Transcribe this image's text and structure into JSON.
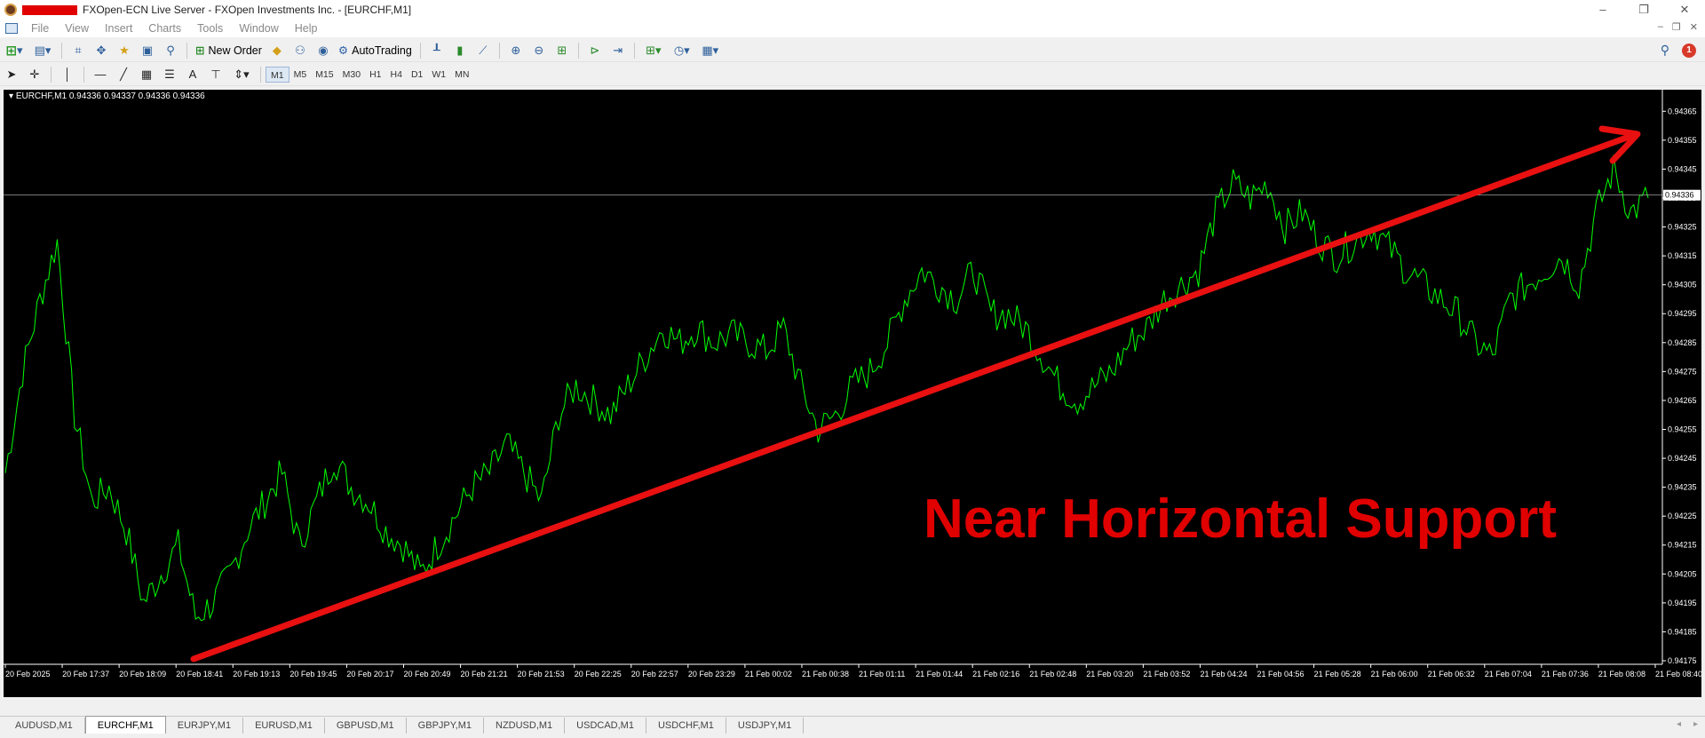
{
  "window": {
    "title": "FXOpen-ECN Live Server - FXOpen Investments Inc. - [EURCHF,M1]",
    "controls": [
      "–",
      "❐",
      "✕"
    ]
  },
  "menu": [
    "File",
    "View",
    "Insert",
    "Charts",
    "Tools",
    "Window",
    "Help"
  ],
  "toolbar": {
    "new_order": "New Order",
    "auto_trading": "AutoTrading",
    "notification_count": "1"
  },
  "timeframes": [
    "M1",
    "M5",
    "M15",
    "M30",
    "H1",
    "H4",
    "D1",
    "W1",
    "MN"
  ],
  "active_timeframe": "M1",
  "chart": {
    "symbol_info": "EURCHF,M1  0.94336 0.94337 0.94336 0.94336",
    "current_price": "0.94336",
    "annotation": "Near Horizontal Support",
    "colors": {
      "background": "#000000",
      "line": "#00ff00",
      "trendline": "#e81010",
      "annotation": "#e00000",
      "axis": "#ffffff"
    }
  },
  "chart_data": {
    "type": "line",
    "ylim": [
      0.94175,
      0.9437
    ],
    "y_ticks": [
      "0.94365",
      "0.94355",
      "0.94345",
      "0.94335",
      "0.94325",
      "0.94315",
      "0.94305",
      "0.94295",
      "0.94285",
      "0.94275",
      "0.94265",
      "0.94255",
      "0.94245",
      "0.94235",
      "0.94225",
      "0.94215",
      "0.94205",
      "0.94195",
      "0.94185",
      "0.94175"
    ],
    "x_ticks": [
      "20 Feb 2025",
      "20 Feb 17:37",
      "20 Feb 18:09",
      "20 Feb 18:41",
      "20 Feb 19:13",
      "20 Feb 19:45",
      "20 Feb 20:17",
      "20 Feb 20:49",
      "20 Feb 21:21",
      "20 Feb 21:53",
      "20 Feb 22:25",
      "20 Feb 22:57",
      "20 Feb 23:29",
      "21 Feb 00:02",
      "21 Feb 00:38",
      "21 Feb 01:11",
      "21 Feb 01:44",
      "21 Feb 02:16",
      "21 Feb 02:48",
      "21 Feb 03:20",
      "21 Feb 03:52",
      "21 Feb 04:24",
      "21 Feb 04:56",
      "21 Feb 05:28",
      "21 Feb 06:00",
      "21 Feb 06:32",
      "21 Feb 07:04",
      "21 Feb 07:36",
      "21 Feb 08:08",
      "21 Feb 08:40"
    ],
    "series": [
      {
        "values": [
          0.9424,
          0.94275,
          0.943,
          0.9432,
          0.9426,
          0.9423,
          0.94235,
          0.9422,
          0.94195,
          0.94205,
          0.94215,
          0.9419,
          0.94195,
          0.94205,
          0.9422,
          0.9423,
          0.9424,
          0.94215,
          0.9423,
          0.94245,
          0.94235,
          0.9423,
          0.9422,
          0.94215,
          0.94205,
          0.94215,
          0.94225,
          0.94235,
          0.9424,
          0.9425,
          0.9424,
          0.9423,
          0.9426,
          0.9427,
          0.94265,
          0.9426,
          0.9427,
          0.9428,
          0.9429,
          0.94285,
          0.9429,
          0.94285,
          0.94288,
          0.94285,
          0.94282,
          0.9429,
          0.9427,
          0.94255,
          0.9426,
          0.9427,
          0.94275,
          0.94285,
          0.943,
          0.9431,
          0.94305,
          0.943,
          0.9431,
          0.94295,
          0.94295,
          0.9429,
          0.9428,
          0.9427,
          0.94265,
          0.9427,
          0.94275,
          0.94285,
          0.9429,
          0.943,
          0.94305,
          0.9431,
          0.9433,
          0.9434,
          0.94335,
          0.9434,
          0.94325,
          0.9433,
          0.9432,
          0.94315,
          0.9432,
          0.94325,
          0.94318,
          0.9431,
          0.94305,
          0.943,
          0.94295,
          0.94285,
          0.9428,
          0.943,
          0.94305,
          0.9431,
          0.94315,
          0.94305,
          0.9433,
          0.94345,
          0.9433,
          0.94335
        ]
      }
    ]
  },
  "tabs": [
    "AUDUSD,M1",
    "EURCHF,M1",
    "EURJPY,M1",
    "EURUSD,M1",
    "GBPUSD,M1",
    "GBPJPY,M1",
    "NZDUSD,M1",
    "USDCAD,M1",
    "USDCHF,M1",
    "USDJPY,M1"
  ],
  "active_tab": "EURCHF,M1"
}
